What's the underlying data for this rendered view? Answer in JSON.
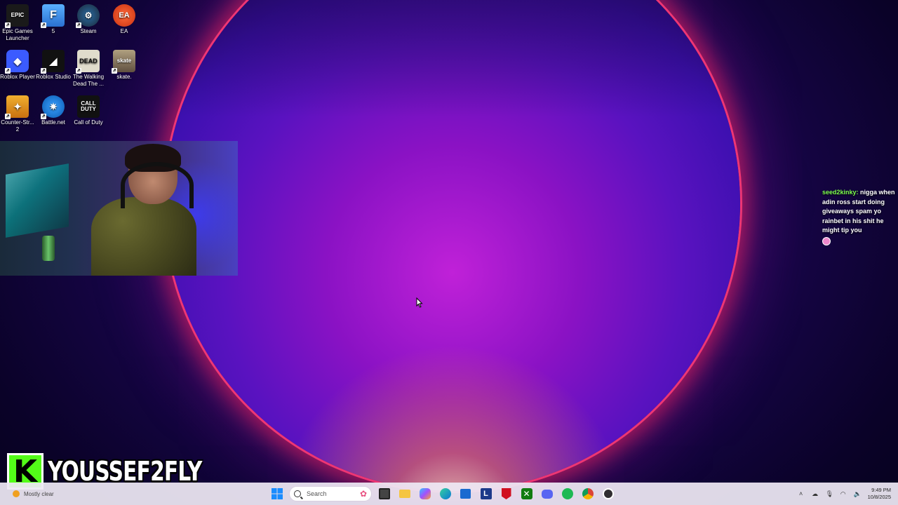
{
  "desktop": {
    "icons": [
      {
        "label": "Epic Games Launcher",
        "icon": "epic-games-icon",
        "color": "#1a1a1a"
      },
      {
        "label": "5",
        "icon": "fortnite-icon",
        "color": "#3a8ee6"
      },
      {
        "label": "Steam",
        "icon": "steam-icon",
        "color": "#1b2838"
      },
      {
        "label": "EA",
        "icon": "ea-icon",
        "color": "#e8451e"
      },
      {
        "label": "Roblox Player",
        "icon": "roblox-icon",
        "color": "#3b5bff"
      },
      {
        "label": "Roblox Studio",
        "icon": "roblox-studio-icon",
        "color": "#111111"
      },
      {
        "label": "The Walking Dead The ...",
        "icon": "walking-dead-icon",
        "color": "#d9d4c4"
      },
      {
        "label": "skate.",
        "icon": "skate-icon",
        "color": "#8a7a60"
      },
      {
        "label": "Counter-Str... 2",
        "icon": "counter-strike-icon",
        "color": "#e89a1c"
      },
      {
        "label": "Battle.net",
        "icon": "battlenet-icon",
        "color": "#148eff"
      },
      {
        "label": "Call of Duty",
        "icon": "call-of-duty-icon",
        "color": "#111111"
      }
    ]
  },
  "overlay": {
    "chat": {
      "username": "seed2kinky:",
      "message": "nigga when adin ross start doing giveaways spam yo rainbet in his shit he might tip you"
    },
    "brand": {
      "logo_letter": "K",
      "streamer_name": "YOUSSEF2FLY",
      "accent": "#53fc18"
    }
  },
  "taskbar": {
    "weather": "Mostly clear",
    "search_placeholder": "Search",
    "apps": [
      "windows-start-icon",
      "task-view-icon",
      "file-explorer-icon",
      "copilot-icon",
      "edge-icon",
      "store-icon",
      "l-app-icon",
      "mcafee-icon",
      "xbox-icon",
      "discord-icon",
      "spotify-icon",
      "chrome-icon",
      "obs-icon"
    ],
    "clock": {
      "time": "9:49 PM",
      "date": "10/8/2025"
    }
  }
}
